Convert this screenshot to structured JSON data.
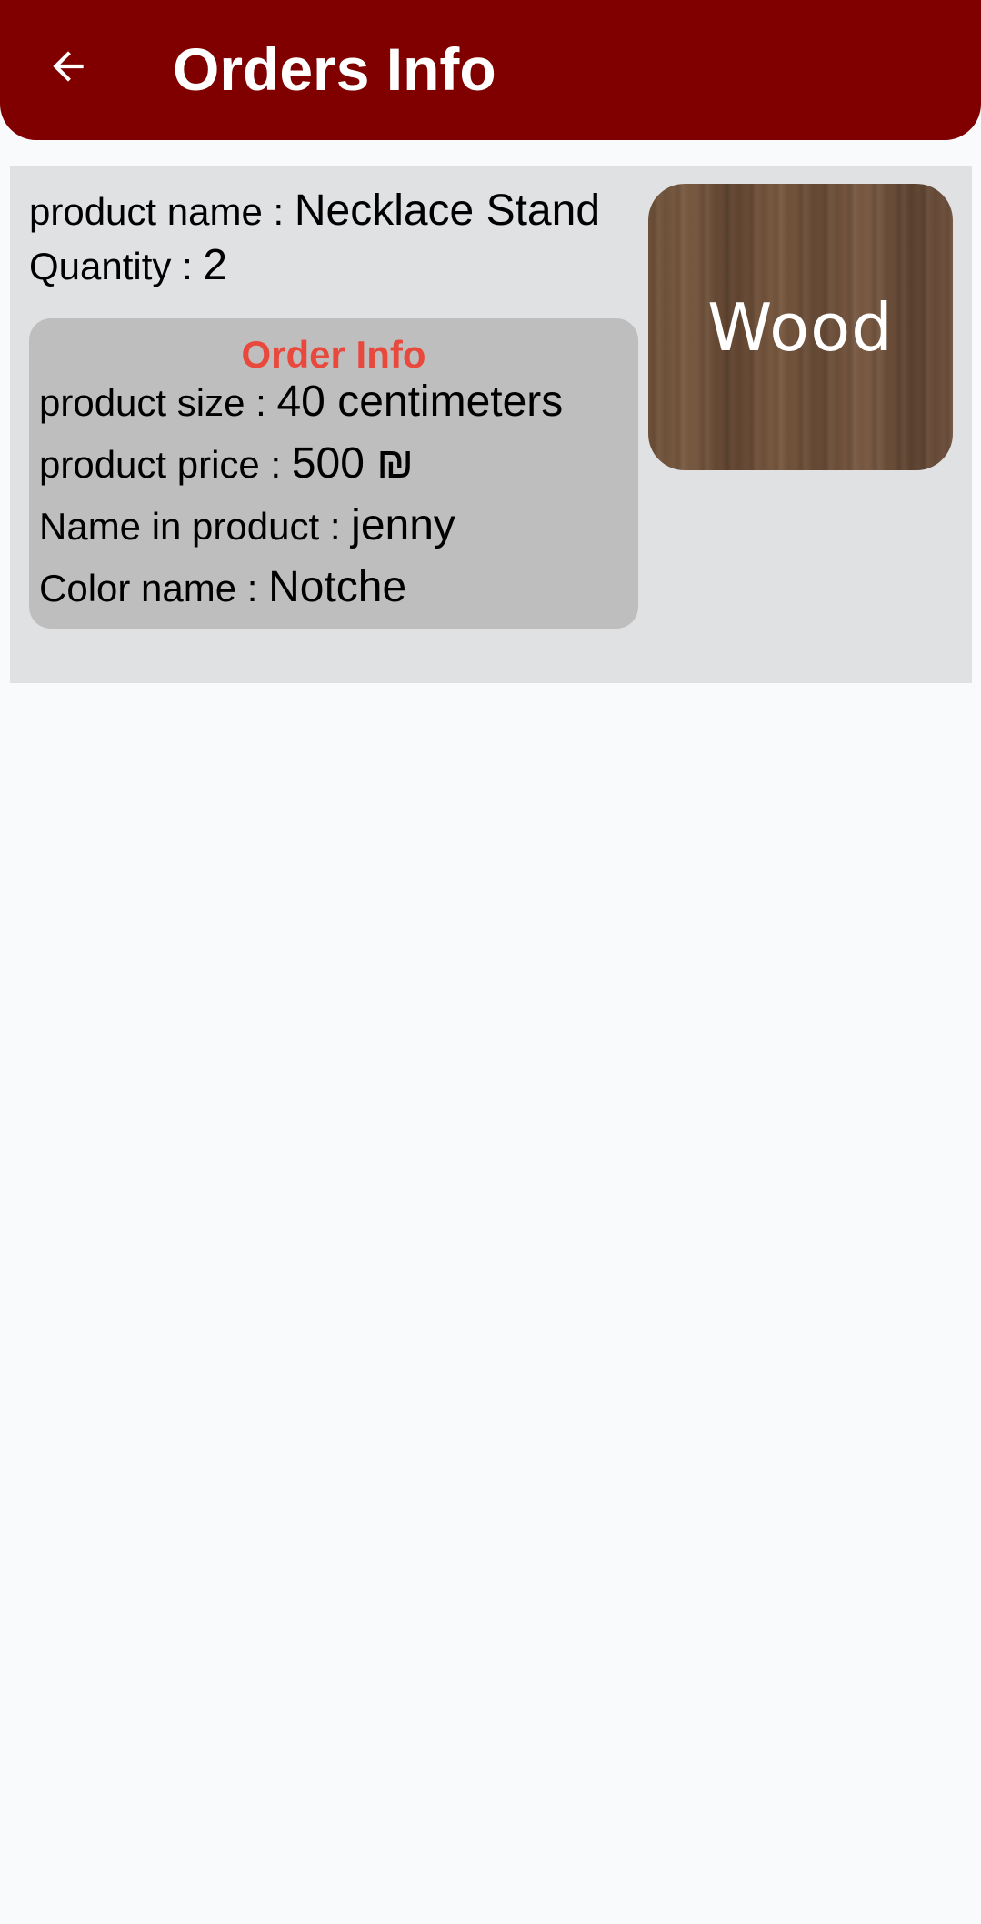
{
  "header": {
    "title": "Orders Info",
    "back_icon": "arrow-left-icon",
    "background_color": "#800000"
  },
  "order": {
    "product_name_label": "product name : ",
    "product_name_value": "Necklace Stand",
    "quantity_label": "Quantity : ",
    "quantity_value": "2",
    "info_title": "Order Info",
    "info_title_color": "#e8493c",
    "size_label": "product size : ",
    "size_value": "40 centimeters",
    "price_label": "product price : ",
    "price_value": "500 ₪",
    "name_in_product_label": "Name in product : ",
    "name_in_product_value": "jenny",
    "color_name_label": "Color name : ",
    "color_name_value": "Notche",
    "material_label": "Wood"
  }
}
